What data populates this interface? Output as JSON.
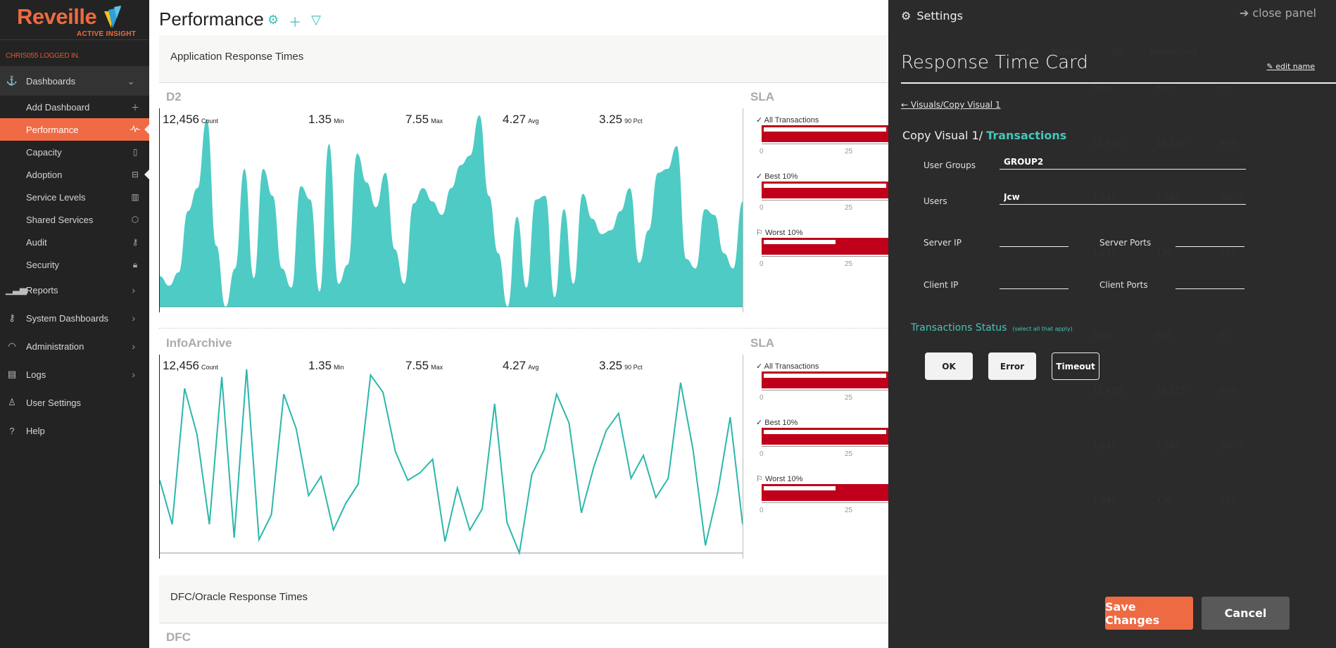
{
  "brand": {
    "name": "Reveille",
    "tagline": "ACTIVE INSIGHT",
    "logged_in": "CHRIS055 LOGGED IN."
  },
  "sidebar": {
    "dashboards": {
      "label": "Dashboards",
      "icon": "anchor-icon",
      "items": [
        {
          "label": "Add Dashboard",
          "icon": "plus-icon"
        },
        {
          "label": "Performance",
          "icon": "pulse-icon",
          "active": true
        },
        {
          "label": "Capacity",
          "icon": "server-icon"
        },
        {
          "label": "Adoption",
          "icon": "briefcase-icon"
        },
        {
          "label": "Service Levels",
          "icon": "sliders-icon"
        },
        {
          "label": "Shared Services",
          "icon": "cube-icon"
        },
        {
          "label": "Audit",
          "icon": "key-icon"
        },
        {
          "label": "Security",
          "icon": "lock-icon"
        }
      ]
    },
    "items": [
      {
        "label": "Reports",
        "icon": "bar-chart-icon"
      },
      {
        "label": "System Dashboards",
        "icon": "key-icon"
      },
      {
        "label": "Administration",
        "icon": "gauge-icon"
      },
      {
        "label": "Logs",
        "icon": "log-icon"
      },
      {
        "label": "User Settings",
        "icon": "user-icon"
      },
      {
        "label": "Help",
        "icon": "question-icon"
      }
    ]
  },
  "main": {
    "title": "Performance",
    "sections": [
      {
        "title": "Application Response Times"
      },
      {
        "title": "DFC/Oracle Response Times"
      }
    ],
    "cards": [
      {
        "name": "D2",
        "stats": {
          "count": "12,456",
          "count_label": "Count",
          "min": "1.35",
          "min_label": "Min",
          "max": "7.55",
          "max_label": "Max",
          "avg": "4.27",
          "avg_label": "Avg",
          "pct": "3.25",
          "pct_label": "90 Pct"
        },
        "sla_title": "SLA",
        "sla": [
          {
            "label": "All Transactions",
            "icon": "check-icon",
            "outer_pct": 100,
            "inner_pct": 100
          },
          {
            "label": "Best 10%",
            "icon": "check-icon",
            "outer_pct": 100,
            "inner_pct": 100
          },
          {
            "label": "Worst 10%",
            "icon": "flag-icon",
            "outer_pct": 100,
            "inner_pct": 60
          }
        ],
        "sla_ticks": [
          "0",
          "25"
        ]
      },
      {
        "name": "InfoArchive",
        "stats": {
          "count": "12,456",
          "count_label": "Count",
          "min": "1.35",
          "min_label": "Min",
          "max": "7.55",
          "max_label": "Max",
          "avg": "4.27",
          "avg_label": "Avg",
          "pct": "3.25",
          "pct_label": "90 Pct"
        },
        "sla_title": "SLA",
        "sla": [
          {
            "label": "All Transactions",
            "icon": "check-icon",
            "outer_pct": 100,
            "inner_pct": 100
          },
          {
            "label": "Best 10%",
            "icon": "check-icon",
            "outer_pct": 100,
            "inner_pct": 100
          },
          {
            "label": "Worst 10%",
            "icon": "flag-icon",
            "outer_pct": 100,
            "inner_pct": 60
          }
        ],
        "sla_ticks": [
          "0",
          "25"
        ]
      },
      {
        "name": "DFC"
      }
    ]
  },
  "chart_data": [
    {
      "type": "area",
      "title": "D2",
      "xlabel": "",
      "ylabel": "",
      "ylim": [
        0,
        100
      ],
      "grid": false,
      "values": [
        16,
        11,
        18,
        50,
        62,
        98,
        32,
        0,
        20,
        72,
        15,
        72,
        58,
        20,
        10,
        63,
        56,
        8,
        85,
        12,
        22,
        80,
        65,
        52,
        70,
        30,
        12,
        54,
        62,
        55,
        48,
        62,
        74,
        79,
        100,
        58,
        28,
        0,
        47,
        10,
        56,
        58,
        5,
        51,
        12,
        59,
        46,
        38,
        40,
        50,
        62,
        23,
        40,
        70,
        72,
        84,
        25,
        20,
        51,
        48,
        28,
        20,
        55
      ]
    },
    {
      "type": "line",
      "title": "InfoArchive",
      "xlabel": "",
      "ylabel": "",
      "ylim": [
        0,
        100
      ],
      "grid": false,
      "values": [
        38,
        15,
        86,
        62,
        15,
        92,
        8,
        96,
        7,
        20,
        83,
        65,
        30,
        40,
        12,
        26,
        36,
        93,
        84,
        53,
        38,
        42,
        49,
        6,
        34,
        12,
        23,
        78,
        16,
        0,
        41,
        54,
        83,
        68,
        21,
        45,
        64,
        73,
        39,
        51,
        29,
        39,
        89,
        54,
        4,
        32,
        71,
        15
      ]
    }
  ],
  "panel": {
    "header": "Settings",
    "close": "close panel",
    "card_title": "Response Time Card",
    "edit_name": "edit name",
    "back_link": "Visuals/Copy Visual 1",
    "crumb_prefix": "Copy Visual 1/",
    "crumb_current": "Transactions",
    "fields": {
      "user_groups_label": "User Groups",
      "user_groups_value": "GROUP2",
      "users_label": "Users",
      "users_value": "Jcw",
      "server_ip_label": "Server IP",
      "server_ip_value": "",
      "server_ports_label": "Server Ports",
      "server_ports_value": "",
      "client_ip_label": "Client IP",
      "client_ip_value": "",
      "client_ports_label": "Client Ports",
      "client_ports_value": ""
    },
    "status_title": "Transactions  Status",
    "status_hint": "(select all that apply)",
    "status_buttons": [
      {
        "label": "OK",
        "selected": true
      },
      {
        "label": "Error",
        "selected": true
      },
      {
        "label": "Timeout",
        "selected": false
      }
    ],
    "save": "Save Changes",
    "cancel": "Cancel",
    "ghost": {
      "filters": [
        "All",
        "None",
        "D2",
        "InfoArchive"
      ],
      "headers": [
        "Total",
        "SLA",
        "%"
      ],
      "rows1": [
        [
          "12,456",
          "10,123",
          "80%"
        ],
        [
          "1,246",
          "1,246",
          "100%"
        ],
        [
          "1,245",
          "436",
          "35%"
        ]
      ],
      "rows2": [
        [
          "12,456",
          "10,123",
          "80%"
        ],
        [
          "1,246",
          "1,246",
          "100%"
        ],
        [
          "1,245",
          "436",
          "35%"
        ]
      ]
    }
  }
}
